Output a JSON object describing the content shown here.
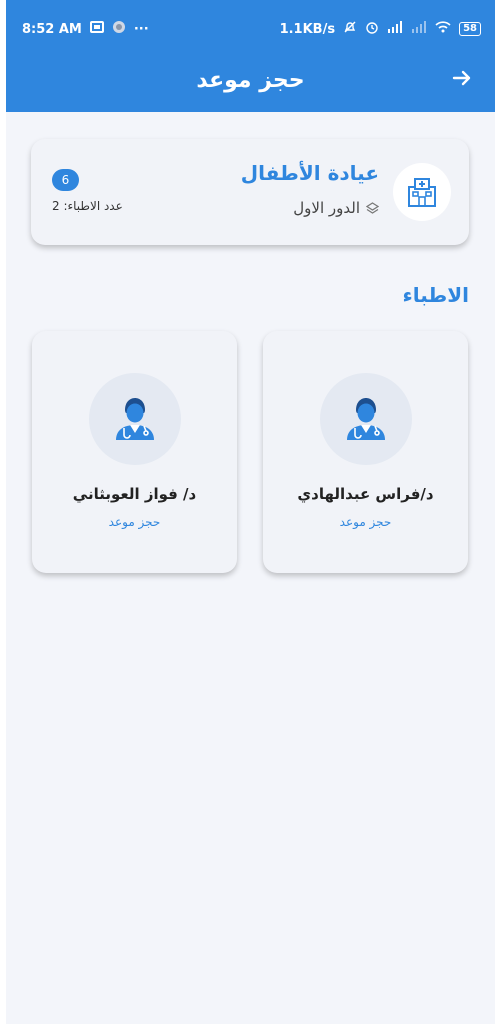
{
  "status_bar": {
    "time": "8:52 AM",
    "network_speed": "1.1KB/s",
    "battery": "58",
    "dots": "···"
  },
  "app_bar": {
    "title": "حجز موعد"
  },
  "clinic": {
    "name": "عيادة الأطفال",
    "floor": "الدور الاول",
    "badge_count": "6",
    "doctor_count_label": "عدد الاطباء: 2"
  },
  "doctors_section": {
    "title": "الاطباء"
  },
  "doctors": [
    {
      "name": "د/فراس عبدالهادي",
      "action": "حجز موعد"
    },
    {
      "name": "د/ فواز العوبثاني",
      "action": "حجز موعد"
    }
  ],
  "colors": {
    "primary": "#2f86de",
    "background": "#f3f5fa",
    "card": "#f1f3f8"
  },
  "icons": {
    "back": "arrow-right-icon",
    "clinic": "hospital-building-icon",
    "floor": "layers-icon",
    "doctor": "doctor-avatar-icon"
  }
}
